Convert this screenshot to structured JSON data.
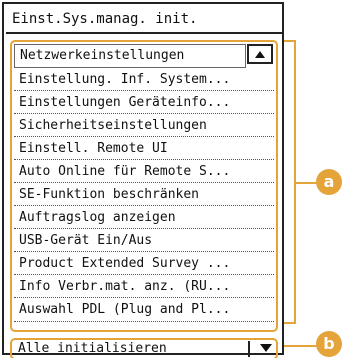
{
  "title": "Einst.Sys.manag. init.",
  "menu_items": [
    "Netzwerkeinstellungen",
    "Einstellung. Inf. System...",
    "Einstellungen Geräteinfo...",
    "Sicherheitseinstellungen",
    "Einstell. Remote UI",
    "Auto Online für Remote S...",
    "SE-Funktion beschränken",
    "Auftragslog anzeigen",
    "USB-Gerät Ein/Aus",
    "Product Extended Survey ...",
    "Info Verbr.mat. anz. (RU...",
    "Auswahl PDL (Plug and Pl..."
  ],
  "reset_selector": {
    "label": "Alle initialisieren"
  },
  "callouts": {
    "a": "a",
    "b": "b"
  },
  "icons": {
    "scroll_up": "triangle-up-icon",
    "dropdown": "triangle-down-icon"
  },
  "colors": {
    "callout": "#e5a43a",
    "border": "#222222"
  }
}
